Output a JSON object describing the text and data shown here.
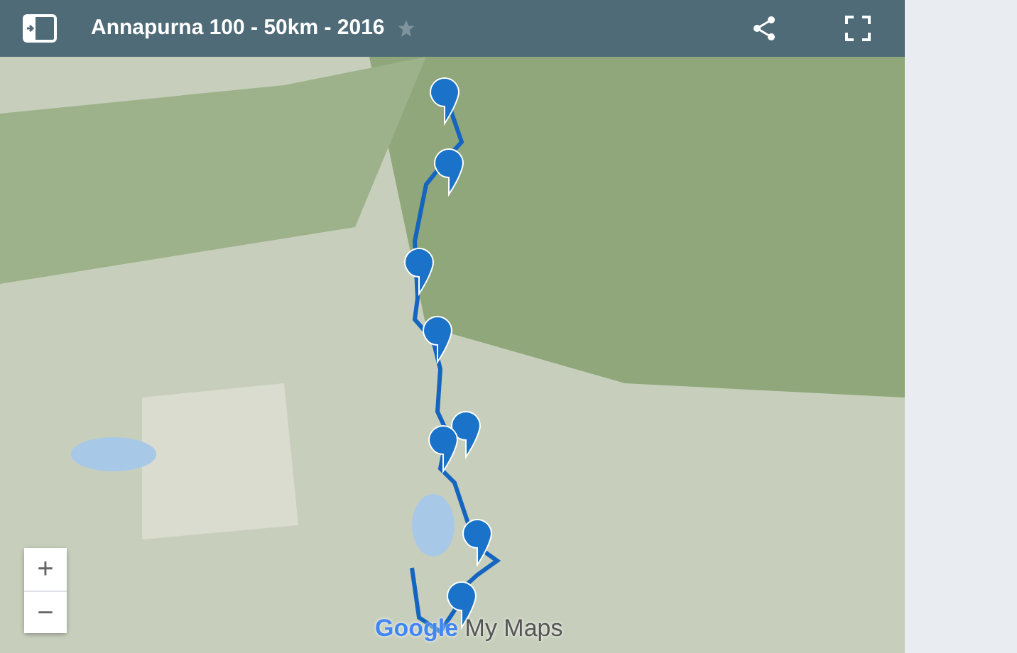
{
  "header": {
    "title": "Annapurna 100 - 50km - 2016",
    "starred": false
  },
  "zoom_controls": [
    "+",
    "−"
  ],
  "map_logo": {
    "brand": "Google",
    "product": "My Maps"
  }
}
